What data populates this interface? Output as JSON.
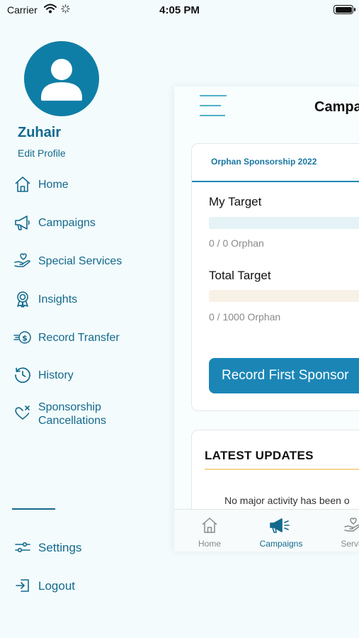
{
  "status_bar": {
    "carrier": "Carrier",
    "time": "4:05 PM"
  },
  "profile": {
    "name": "Zuhair",
    "edit_label": "Edit Profile"
  },
  "drawer": {
    "items": [
      {
        "label": "Home",
        "icon": "home-icon"
      },
      {
        "label": "Campaigns",
        "icon": "megaphone-icon"
      },
      {
        "label": "Special Services",
        "icon": "heart-hand-icon"
      },
      {
        "label": "Insights",
        "icon": "award-icon"
      },
      {
        "label": "Record Transfer",
        "icon": "money-transfer-icon"
      },
      {
        "label": "History",
        "icon": "history-icon"
      },
      {
        "label": "Sponsorship Cancellations",
        "icon": "heart-cancel-icon"
      }
    ],
    "settings_label": "Settings",
    "logout_label": "Logout"
  },
  "main": {
    "title": "Campa",
    "campaign_tab": "Orphan Sponsorship 2022",
    "my_target": {
      "title": "My Target",
      "text": "0 / 0 Orphan",
      "progress": 0
    },
    "total_target": {
      "title": "Total Target",
      "text": "0 / 1000 Orphan",
      "progress": 0
    },
    "cta_label": "Record First Sponsor",
    "latest_updates": {
      "title": "LATEST UPDATES",
      "empty_text": "No major activity has been o"
    }
  },
  "tabbar": {
    "items": [
      {
        "label": "Home",
        "icon": "home-icon",
        "active": false
      },
      {
        "label": "Campaigns",
        "icon": "megaphone-icon",
        "active": true
      },
      {
        "label": "Servic",
        "icon": "heart-hand-icon",
        "active": false
      }
    ]
  },
  "colors": {
    "background": "#f3fbfc",
    "accent": "#13698d",
    "primary_button": "#1b86b6",
    "my_target_bar": "#e5f2f6",
    "total_target_bar": "#f8f1e6",
    "highlight_line": "#f3d693"
  }
}
